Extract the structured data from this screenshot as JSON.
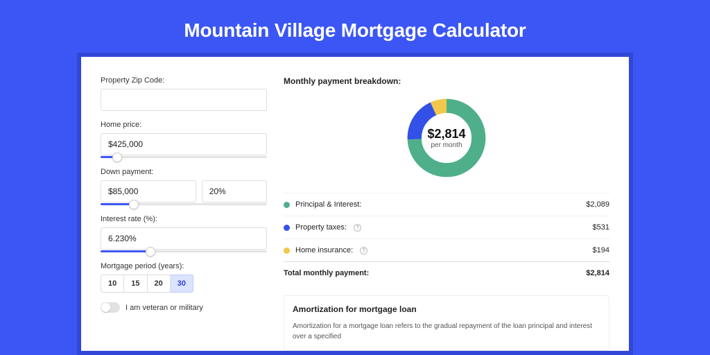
{
  "title": "Mountain Village Mortgage Calculator",
  "form": {
    "zip": {
      "label": "Property Zip Code:",
      "value": ""
    },
    "home_price": {
      "label": "Home price:",
      "value": "$425,000",
      "slider_pct": 10
    },
    "down_payment": {
      "label": "Down payment:",
      "value": "$85,000",
      "pct_value": "20%",
      "slider_pct": 20
    },
    "interest_rate": {
      "label": "Interest rate (%):",
      "value": "6.230%",
      "slider_pct": 30
    },
    "mortgage_period": {
      "label": "Mortgage period (years):",
      "options": [
        "10",
        "15",
        "20",
        "30"
      ],
      "selected": "30"
    },
    "veteran": {
      "label": "I am veteran or military",
      "checked": false
    }
  },
  "breakdown": {
    "title": "Monthly payment breakdown:",
    "per_month_label": "per month",
    "items": [
      {
        "label": "Principal & Interest:",
        "value": "$2,089",
        "color": "#4FAF8B",
        "has_info": false
      },
      {
        "label": "Property taxes:",
        "value": "$531",
        "color": "#3351E6",
        "has_info": true
      },
      {
        "label": "Home insurance:",
        "value": "$194",
        "color": "#F1C84B",
        "has_info": true
      }
    ],
    "total": {
      "label": "Total monthly payment:",
      "value": "$2,814"
    }
  },
  "amortization": {
    "title": "Amortization for mortgage loan",
    "text": "Amortization for a mortgage loan refers to the gradual repayment of the loan principal and interest over a specified"
  },
  "chart_data": {
    "type": "pie",
    "title": "Monthly payment breakdown",
    "center_value": "$2,814",
    "center_sub": "per month",
    "series": [
      {
        "name": "Principal & Interest",
        "value": 2089,
        "color": "#4FAF8B"
      },
      {
        "name": "Property taxes",
        "value": 531,
        "color": "#3351E6"
      },
      {
        "name": "Home insurance",
        "value": 194,
        "color": "#F1C84B"
      }
    ],
    "total": 2814
  }
}
